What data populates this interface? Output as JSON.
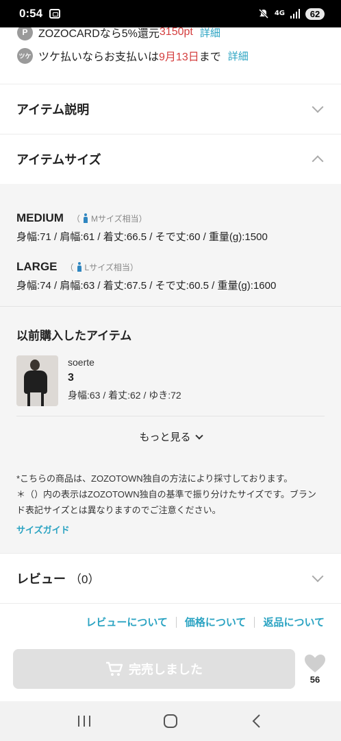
{
  "status": {
    "time": "0:54",
    "network": "4G",
    "battery": "62"
  },
  "payments": [
    {
      "icon_text": "P",
      "text": "ZOZOCARDなら5%還元 ",
      "highlight": "3150pt",
      "after": "",
      "link": "詳細"
    },
    {
      "icon_text": "ツケ",
      "text": "ツケ払いならお支払いは",
      "highlight": "9月13日",
      "after": "まで",
      "link": "詳細"
    }
  ],
  "sections": {
    "description": "アイテム説明",
    "size": "アイテムサイズ"
  },
  "sizes": [
    {
      "name": "MEDIUM",
      "equiv_open": "（",
      "equiv": "Mサイズ相当）",
      "measurements": "身幅:71 / 肩幅:61 / 着丈:66.5 / そで丈:60 / 重量(g):1500"
    },
    {
      "name": "LARGE",
      "equiv_open": "（",
      "equiv": "Lサイズ相当）",
      "measurements": "身幅:74 / 肩幅:63 / 着丈:67.5 / そで丈:60.5 / 重量(g):1600"
    }
  ],
  "previous": {
    "title": "以前購入したアイテム",
    "item": {
      "brand": "soerte",
      "size": "3",
      "measurements": "身幅:63 / 着丈:62 / ゆき:72"
    },
    "more": "もっと見る"
  },
  "notes": {
    "line1": "*こちらの商品は、ZOZOTOWN独自の方法により採寸しております。",
    "line2": "＊（）内の表示はZOZOTOWN独自の基準で振り分けたサイズです。ブランド表記サイズとは異なりますのでご注意ください。",
    "guide": "サイズガイド"
  },
  "review": {
    "title": "レビュー",
    "count": "（0）"
  },
  "links": [
    "レビューについて",
    "価格について",
    "返品について"
  ],
  "bottom": {
    "soldout": "完売しました",
    "favorites": "56"
  },
  "colors": {
    "accent": "#2aa3c2",
    "highlight_red": "#d43d3d",
    "person_icon": "#2f86c0"
  }
}
